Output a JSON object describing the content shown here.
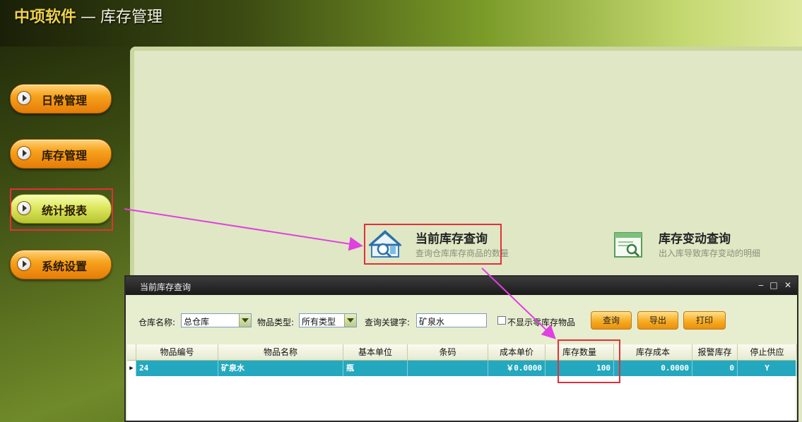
{
  "app": {
    "title_main": "中项软件",
    "title_sep": "—",
    "title_sub": "库存管理"
  },
  "sidebar": {
    "items": [
      {
        "label": "日常管理"
      },
      {
        "label": "库存管理"
      },
      {
        "label": "统计报表"
      },
      {
        "label": "系统设置"
      }
    ]
  },
  "functions": [
    {
      "title": "当前库存查询",
      "desc": "查询仓库库存商品的数量",
      "icon": "warehouse-search-icon"
    },
    {
      "title": "库存变动查询",
      "desc": "出入库导致库存变动的明细",
      "icon": "window-search-icon"
    }
  ],
  "dialog": {
    "title": "当前库存查询",
    "filters": {
      "warehouse_label": "仓库名称:",
      "warehouse_value": "总仓库",
      "type_label": "物品类型:",
      "type_value": "所有类型",
      "keyword_label": "查询关键字:",
      "keyword_value": "矿泉水",
      "zero_stock_label": "不显示零库存物品"
    },
    "buttons": {
      "query": "查询",
      "export": "导出",
      "print": "打印"
    },
    "grid": {
      "headers": [
        "物品编号",
        "物品名称",
        "基本单位",
        "条码",
        "成本单价",
        "库存数量",
        "库存成本",
        "报警库存",
        "停止供应"
      ],
      "row": {
        "code": "24",
        "name": "矿泉水",
        "unit": "瓶",
        "barcode": "",
        "unit_cost": "￥0.0000",
        "qty": "100",
        "stock_cost": "0.0000",
        "alarm": "0",
        "stop": "Y"
      }
    }
  },
  "colors": {
    "highlight": "#e0303a",
    "arrow": "#e040e0",
    "row_selected": "#24a8bf"
  }
}
